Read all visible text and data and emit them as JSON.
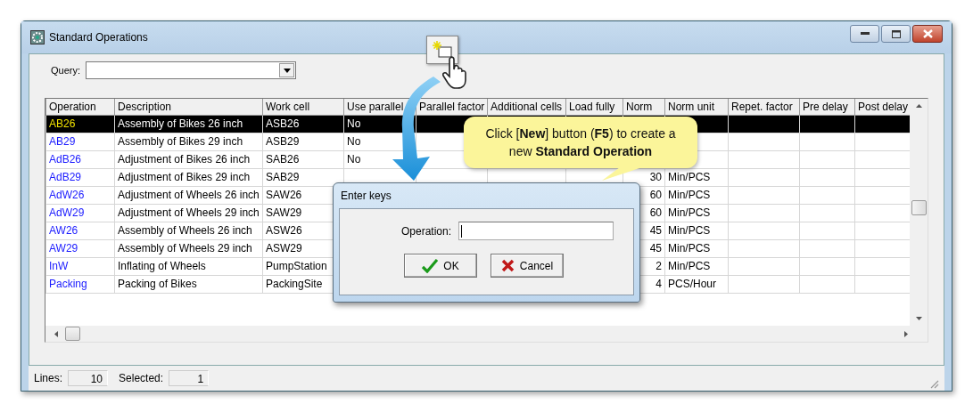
{
  "window": {
    "title": "Standard Operations"
  },
  "query": {
    "label": "Query:"
  },
  "table": {
    "columns": [
      "Operation",
      "Description",
      "Work cell",
      "Use parallel",
      "Parallel factor",
      "Additional cells",
      "Load fully",
      "Norm",
      "Norm unit",
      "Repet. factor",
      "Pre delay",
      "Post delay"
    ],
    "rows": [
      {
        "selected": true,
        "cells": [
          "AB26",
          "Assembly of Bikes 26 inch",
          "ASB26",
          "No",
          null,
          null,
          null,
          null,
          null,
          null,
          null,
          null
        ]
      },
      {
        "selected": false,
        "cells": [
          "AB29",
          "Assembly of Bikes 29 inch",
          "ASB29",
          "No",
          null,
          null,
          null,
          null,
          null,
          null,
          null,
          null
        ]
      },
      {
        "selected": false,
        "cells": [
          "AdB26",
          "Adjustment of Bikes 26 inch",
          "SAB26",
          "No",
          null,
          null,
          null,
          null,
          null,
          null,
          null,
          null
        ]
      },
      {
        "selected": false,
        "cells": [
          "AdB29",
          "Adjustment of Bikes 29 inch",
          "SAB29",
          null,
          null,
          null,
          null,
          "30",
          "Min/PCS",
          null,
          null,
          null
        ]
      },
      {
        "selected": false,
        "cells": [
          "AdW26",
          "Adjustment of Wheels 26 inch",
          "SAW26",
          null,
          null,
          null,
          null,
          "60",
          "Min/PCS",
          null,
          null,
          null
        ]
      },
      {
        "selected": false,
        "cells": [
          "AdW29",
          "Adjustment of Wheels 29 inch",
          "SAW29",
          null,
          null,
          null,
          null,
          "60",
          "Min/PCS",
          null,
          null,
          null
        ]
      },
      {
        "selected": false,
        "cells": [
          "AW26",
          "Assembly of Wheels 26 inch",
          "ASW26",
          null,
          null,
          null,
          null,
          "45",
          "Min/PCS",
          null,
          null,
          null
        ]
      },
      {
        "selected": false,
        "cells": [
          "AW29",
          "Assembly of Wheels 29 inch",
          "ASW29",
          null,
          null,
          null,
          null,
          "45",
          "Min/PCS",
          null,
          null,
          null
        ]
      },
      {
        "selected": false,
        "cells": [
          "InW",
          "Inflating of Wheels",
          "PumpStation",
          null,
          null,
          null,
          null,
          "2",
          "Min/PCS",
          null,
          null,
          null
        ]
      },
      {
        "selected": false,
        "cells": [
          "Packing",
          "Packing of Bikes",
          "PackingSite",
          null,
          null,
          null,
          null,
          "4",
          "PCS/Hour",
          null,
          null,
          null
        ]
      }
    ]
  },
  "status_bar": {
    "lines_label": "Lines:",
    "lines": "10",
    "selected_label": "Selected:",
    "selected": "1"
  },
  "callout": {
    "text": "Click [**New**] button (**F5**) to create a new **Standard Operation**"
  },
  "dialog": {
    "title": "Enter keys",
    "field_label": "Operation:",
    "buttons": [
      {
        "label": "OK",
        "kind": "ok"
      },
      {
        "label": "Cancel",
        "kind": "cancel"
      }
    ]
  }
}
